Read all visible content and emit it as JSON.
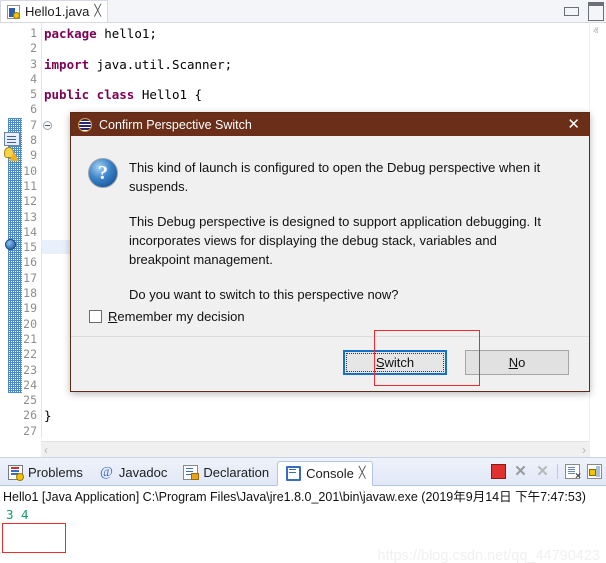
{
  "window": {
    "minimize_label": "Minimize",
    "maximize_label": "Maximize"
  },
  "editor": {
    "tab": {
      "label": "Hello1.java",
      "close": "╳",
      "icon": "java-file-icon"
    },
    "first_line": 1,
    "last_line": 27,
    "lines": [
      {
        "n": 1,
        "tokens": [
          {
            "t": "package",
            "k": true
          },
          {
            "t": " hello1;",
            "k": false
          }
        ]
      },
      {
        "n": 2,
        "tokens": []
      },
      {
        "n": 3,
        "tokens": [
          {
            "t": "import",
            "k": true
          },
          {
            "t": " java.util.Scanner;",
            "k": false
          }
        ]
      },
      {
        "n": 4,
        "tokens": []
      },
      {
        "n": 5,
        "tokens": [
          {
            "t": "public class",
            "k": true
          },
          {
            "t": " Hello1 {",
            "k": false
          }
        ]
      },
      {
        "n": 6,
        "tokens": []
      },
      {
        "n": 7,
        "tokens": []
      },
      {
        "n": 8,
        "tokens": []
      },
      {
        "n": 9,
        "tokens": []
      },
      {
        "n": 10,
        "tokens": []
      },
      {
        "n": 11,
        "tokens": []
      },
      {
        "n": 12,
        "tokens": []
      },
      {
        "n": 13,
        "tokens": []
      },
      {
        "n": 14,
        "tokens": []
      },
      {
        "n": 15,
        "tokens": []
      },
      {
        "n": 16,
        "tokens": []
      },
      {
        "n": 17,
        "tokens": []
      },
      {
        "n": 18,
        "tokens": []
      },
      {
        "n": 19,
        "tokens": []
      },
      {
        "n": 20,
        "tokens": []
      },
      {
        "n": 21,
        "tokens": []
      },
      {
        "n": 22,
        "tokens": []
      },
      {
        "n": 23,
        "tokens": []
      },
      {
        "n": 24,
        "tokens": []
      },
      {
        "n": 25,
        "tokens": []
      },
      {
        "n": 26,
        "tokens": [
          {
            "t": "}",
            "k": false
          }
        ]
      },
      {
        "n": 27,
        "tokens": []
      }
    ],
    "markers": {
      "fold_line": 7,
      "edit_marker_line": 8,
      "warning_marker_line": 9,
      "breakpoint_marker_line": 15,
      "current_line": 15,
      "annotation_bar_from": 7,
      "annotation_bar_to": 24
    },
    "scroll_left_arrow": "‹",
    "scroll_right_arrow": "›",
    "scroll_up_arrow": "ⱏ",
    "scroll_down_arrow": "ⱟ"
  },
  "dialog": {
    "title": "Confirm Perspective Switch",
    "close_label": "✕",
    "icon": "eclipse-logo-icon",
    "info_icon": "question-mark-icon",
    "question_glyph": "?",
    "paragraphs": [
      "This kind of launch is configured to open the Debug perspective when it suspends.",
      "This Debug perspective is designed to support application debugging. It incorporates views for displaying the debug stack, variables and breakpoint management.",
      "Do you want to switch to this perspective now?"
    ],
    "checkbox": {
      "checked": false,
      "label_pre": "",
      "label_mnemonic": "R",
      "label_post": "emember my decision",
      "label_full": "Remember my decision"
    },
    "buttons": {
      "switch": {
        "mnemonic": "S",
        "rest": "witch",
        "full": "Switch",
        "focused": true
      },
      "no": {
        "mnemonic": "N",
        "rest": "o",
        "full": "No",
        "focused": false
      }
    }
  },
  "annotations": {
    "switch_button_highlight_color": "#ef2b2b",
    "console_output_highlight_color": "#ef2b2b"
  },
  "bottom_panel": {
    "tabs": [
      {
        "label": "Problems",
        "icon": "problems-icon",
        "active": false,
        "closeable": false
      },
      {
        "label": "Javadoc",
        "icon": "javadoc-at-icon",
        "active": false,
        "closeable": false
      },
      {
        "label": "Declaration",
        "icon": "declaration-icon",
        "active": false,
        "closeable": false
      },
      {
        "label": "Console",
        "icon": "console-icon",
        "active": true,
        "closeable": true
      }
    ],
    "tab_close_glyph": "╳",
    "toolbar": [
      {
        "name": "terminate-button",
        "icon": "stop-square-icon"
      },
      {
        "name": "remove-launch-button",
        "icon": "x-gray-icon",
        "glyph": "✕"
      },
      {
        "name": "remove-all-terminated-button",
        "icon": "x-light-gray-icon",
        "glyph": "✕"
      },
      {
        "name": "clear-console-button",
        "icon": "clear-console-icon"
      },
      {
        "name": "scroll-lock-button",
        "icon": "lock-icon"
      }
    ],
    "console": {
      "header": "Hello1 [Java Application] C:\\Program Files\\Java\\jre1.8.0_201\\bin\\javaw.exe (2019年9月14日 下午7:47:53)",
      "output": "3 4"
    }
  },
  "watermark": "https://blog.csdn.net/qq_44790423"
}
